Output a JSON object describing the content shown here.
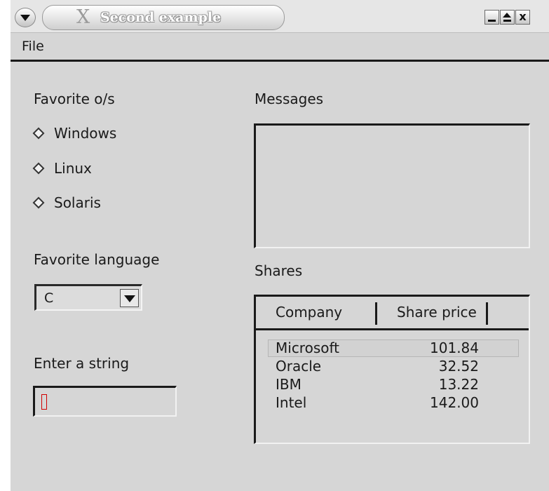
{
  "window": {
    "title": "Second example",
    "x_logo": "X",
    "close_glyph": "x"
  },
  "menubar": {
    "items": [
      {
        "label": "File"
      }
    ]
  },
  "os_group": {
    "title": "Favorite o/s",
    "options": [
      {
        "label": "Windows"
      },
      {
        "label": "Linux"
      },
      {
        "label": "Solaris"
      }
    ]
  },
  "language": {
    "title": "Favorite language",
    "selected": "C"
  },
  "entry": {
    "title": "Enter a string",
    "value": ""
  },
  "messages": {
    "title": "Messages"
  },
  "shares": {
    "title": "Shares",
    "columns": [
      "Company",
      "Share price"
    ],
    "rows": [
      {
        "company": "Microsoft",
        "price": "101.84"
      },
      {
        "company": "Oracle",
        "price": "32.52"
      },
      {
        "company": "IBM",
        "price": "13.22"
      },
      {
        "company": "Intel",
        "price": "142.00"
      }
    ]
  },
  "icons": {
    "window_menu": "chevron-down-icon",
    "minimize": "minimize-icon",
    "maximize": "maximize-icon",
    "close": "close-icon",
    "combo_arrow": "chevron-down-icon",
    "radio": "diamond-radio-icon"
  },
  "colors": {
    "background": "#d6d6d6",
    "caret": "#d00000"
  }
}
